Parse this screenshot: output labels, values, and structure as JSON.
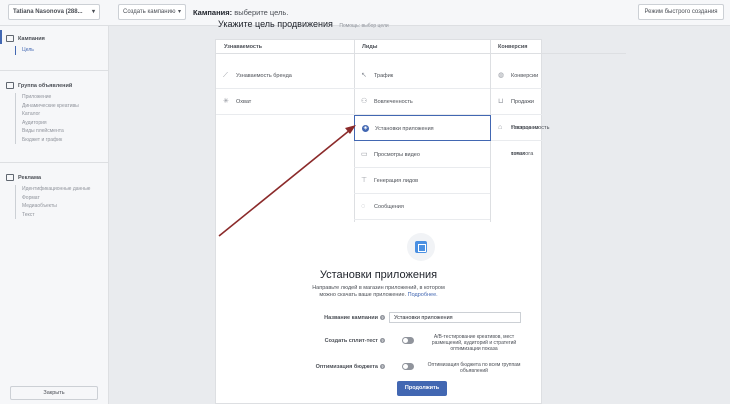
{
  "topbar": {
    "account": "Tatiana Nasonova (288...",
    "create_campaign": "Создать кампанию",
    "title_bold": "Кампания:",
    "title_rest": "выберите цель.",
    "quick_mode": "Режим быстрого создания"
  },
  "sidebar": {
    "campaign": {
      "label": "Кампания",
      "items": [
        "Цель"
      ]
    },
    "adset": {
      "label": "Группа объявлений",
      "items": [
        "Приложение",
        "Динамические креативы",
        "Каталог",
        "Аудитория",
        "Виды плейсмента",
        "Бюджет и график"
      ]
    },
    "ad": {
      "label": "Реклама",
      "items": [
        "Идентификационные данные",
        "Формат",
        "Медиаобъекты",
        "Текст"
      ]
    },
    "close": "Закрыть"
  },
  "goal": {
    "title": "Укажите цель продвижения",
    "help": "Помощь: выбор цели"
  },
  "columns": [
    {
      "head": "Узнаваемость",
      "options": [
        {
          "label": "Узнаваемость бренда",
          "icon": "megaphone-icon"
        },
        {
          "label": "Охват",
          "icon": "reach-icon"
        }
      ]
    },
    {
      "head": "Лиды",
      "options": [
        {
          "label": "Трафик",
          "icon": "cursor-icon"
        },
        {
          "label": "Вовлеченность",
          "icon": "people-icon"
        },
        {
          "label": "Установки приложения",
          "icon": "app-cube-icon"
        },
        {
          "label": "Просмотры видео",
          "icon": "video-icon"
        },
        {
          "label": "Генерация лидов",
          "icon": "filter-icon"
        },
        {
          "label": "Сообщения",
          "icon": "chat-icon"
        }
      ]
    },
    {
      "head": "Конверсия",
      "options": [
        {
          "label": "Конверсии",
          "icon": "globe-icon"
        },
        {
          "label": "Продажи товаров из каталога",
          "icon": "cart-icon"
        },
        {
          "label": "Посещаемость точек",
          "icon": "store-icon"
        }
      ]
    }
  ],
  "selected": "Установки приложения",
  "detail": {
    "title": "Установки приложения",
    "desc": "Направьте людей в магазин приложений, в котором можно скачать ваше приложение.",
    "desc_link": "Подробнее.",
    "name_label": "Название кампании",
    "name_value": "Установки приложения",
    "split_label": "Создать сплит-тест",
    "split_text": "A/B-тестирование креативов, мест размещений, аудиторий и стратегий оптимизации показа",
    "budget_label": "Оптимизация бюджета",
    "budget_text": "Оптимизация бюджета по всем группам объявлений",
    "continue": "Продолжить"
  },
  "colors": {
    "accent": "#4267b2",
    "arrow": "#8b2a2a"
  }
}
